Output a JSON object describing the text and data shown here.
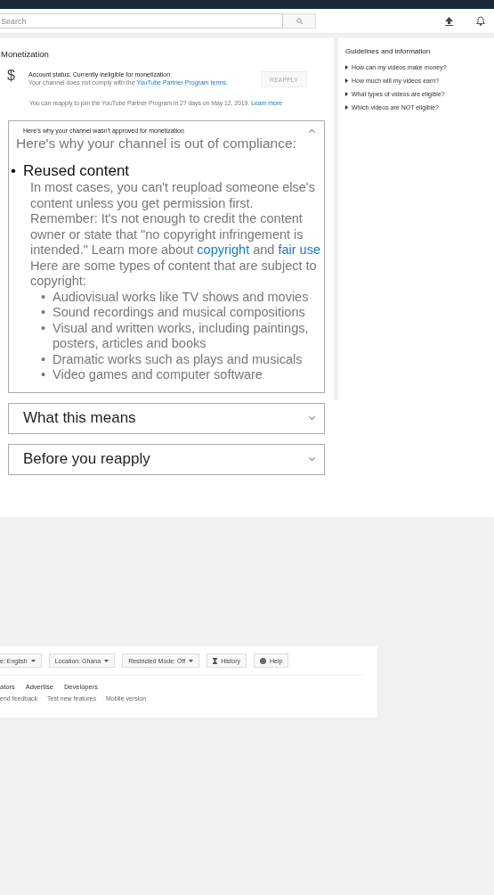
{
  "header": {
    "search": {
      "placeholder": "Search"
    }
  },
  "monetization": {
    "title": "Monetization",
    "icon": "$",
    "status_title": "Account status: Currently ineligible for monetization",
    "status_text": "Your channel does not comply with the",
    "status_link": "YouTube Partner Program terms.",
    "reapply_button": {
      "label": "REAPPLY",
      "disabled": true
    },
    "reapply_note": "You can reapply to join the YouTube Partner Program in 27 days on May 12, 2019.",
    "reapply_link": "Learn more"
  },
  "sections": [
    {
      "heading": "Here's why your channel wasn't approved for monetization",
      "expanded": true,
      "intro": "Here's why your channel is out of compliance:",
      "reason_marker": "•",
      "reason": "Reused content",
      "paragraph_1": "In most cases, you can't reupload someone else's content unless you get permission first.",
      "paragraph_2": "Remember: It's not enough to credit the content owner or state that \"no copyright infringement is intended.\" Learn more about",
      "link_1": "copyright",
      "joiner": "and",
      "link_2": "fair use",
      "paragraph_3": "Here are some types of content that are subject to copyright:",
      "items": [
        {
          "marker": "•",
          "text": "Audiovisual works like TV shows and movies"
        },
        {
          "marker": "•",
          "text": "Sound recordings and musical compositions"
        },
        {
          "marker": "•",
          "text": "Visual and written works, including paintings, posters, articles and books"
        },
        {
          "marker": "•",
          "text": "Dramatic works such as plays and musicals"
        },
        {
          "marker": "•",
          "text": "Video games and computer software"
        }
      ]
    },
    {
      "heading": "What this means",
      "expanded": false
    },
    {
      "heading": "Before you reapply",
      "expanded": false
    }
  ],
  "guidelines": {
    "title": "Guidelines and information",
    "items": [
      "How can my videos make money?",
      "How much will my videos earn?",
      "What types of videos are eligible?",
      "Which videos are NOT eligible?"
    ]
  },
  "footer": {
    "pickers": [
      {
        "kind": "dropdown",
        "label": "e: English"
      },
      {
        "kind": "dropdown",
        "label": "Location: Ghana"
      },
      {
        "kind": "dropdown",
        "label": "Restricted Mode: Off"
      },
      {
        "kind": "history",
        "label": "History"
      },
      {
        "kind": "help",
        "label": "Help"
      }
    ],
    "primary_links": [
      "ators",
      "Advertise",
      "Developers"
    ],
    "secondary_links": [
      "end feedback",
      "Test new features",
      "Mobile version"
    ]
  }
}
